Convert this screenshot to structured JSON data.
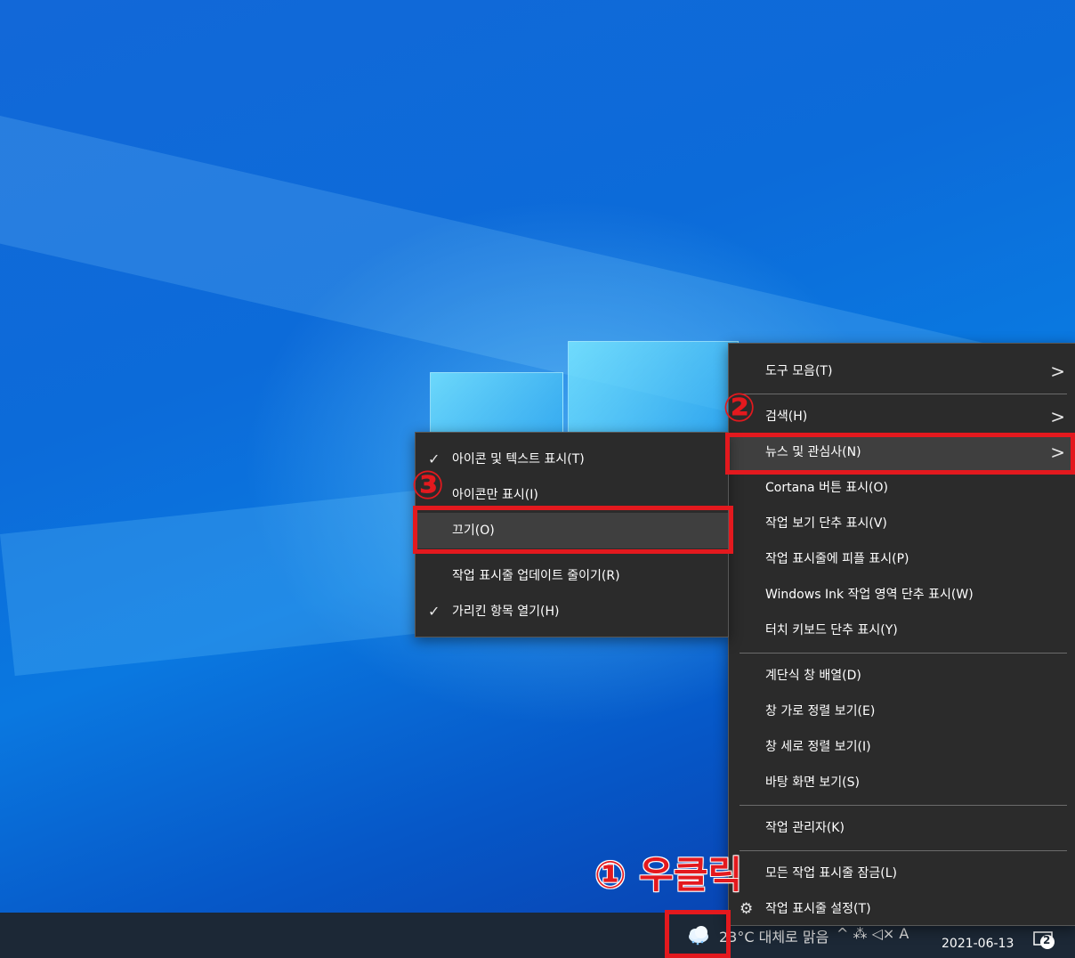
{
  "taskbar": {
    "weather_text": "23°C 대체로 맑음",
    "tray_symbols": "^  ⁂  ◁× A",
    "date": "2021-06-13",
    "notification_count": "2"
  },
  "main_menu": {
    "items": [
      {
        "label": "도구 모음(T)"
      },
      {
        "label": "검색(H)"
      },
      {
        "label": "뉴스 및 관심사(N)"
      },
      {
        "label": "Cortana 버튼 표시(O)"
      },
      {
        "label": "작업 보기 단추 표시(V)"
      },
      {
        "label": "작업 표시줄에 피플 표시(P)"
      },
      {
        "label": "Windows Ink 작업 영역 단추 표시(W)"
      },
      {
        "label": "터치 키보드 단추 표시(Y)"
      },
      {
        "label": "계단식 창 배열(D)"
      },
      {
        "label": "창 가로 정렬 보기(E)"
      },
      {
        "label": "창 세로 정렬 보기(I)"
      },
      {
        "label": "바탕 화면 보기(S)"
      },
      {
        "label": "작업 관리자(K)"
      },
      {
        "label": "모든 작업 표시줄 잠금(L)"
      },
      {
        "label": "작업 표시줄 설정(T)"
      }
    ]
  },
  "sub_menu": {
    "items": [
      {
        "label": "아이콘 및 텍스트 표시(T)"
      },
      {
        "label": "아이콘만 표시(I)"
      },
      {
        "label": "끄기(O)"
      },
      {
        "label": "작업 표시줄 업데이트 줄이기(R)"
      },
      {
        "label": "가리킨 항목 열기(H)"
      }
    ]
  },
  "annotations": {
    "step1": "① 우클릭",
    "step2": "②",
    "step3": "③"
  },
  "colors": {
    "highlight_red": "#e3191e",
    "menu_bg": "#2b2b2b",
    "taskbar_bg": "#1c2836"
  },
  "icons": {
    "submenu_arrow": "chevron-right-icon",
    "check": "check-icon",
    "settings": "gear-icon",
    "weather": "cloud-icon"
  }
}
